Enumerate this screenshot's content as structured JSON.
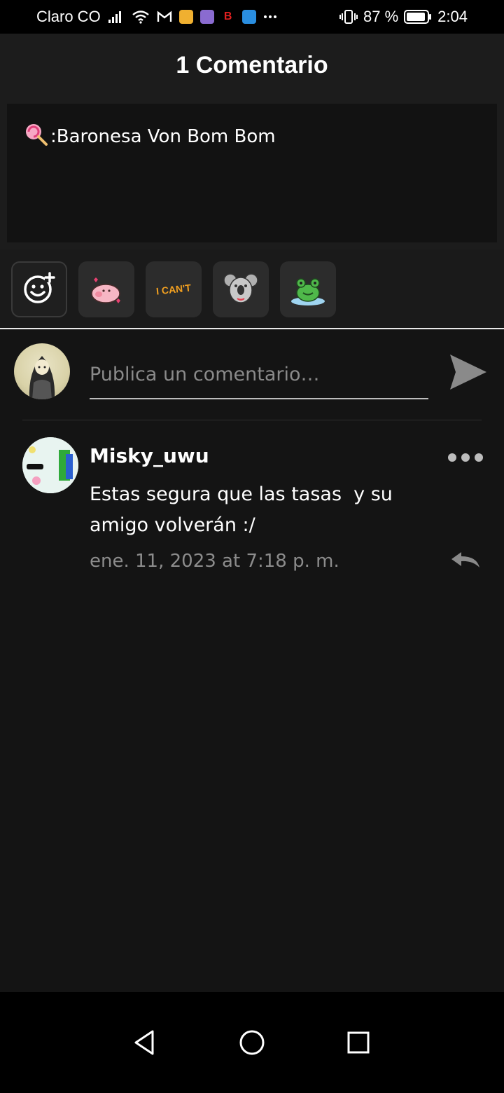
{
  "status_bar": {
    "carrier": "Claro CO",
    "battery_percent": "87 %",
    "time": "2:04",
    "icons": [
      "signal-icon",
      "wifi-icon",
      "gmail-icon",
      "app-icon",
      "app-icon",
      "app-icon",
      "app-icon",
      "more-notifications-icon",
      "vibrate-icon",
      "battery-icon"
    ]
  },
  "header": {
    "title": "1 Comentario"
  },
  "post": {
    "emoji": "🍭",
    "text": ":Baronesa Von Bom Bom"
  },
  "stickers": {
    "items": [
      {
        "name": "add-sticker-icon"
      },
      {
        "name": "pig-sticker"
      },
      {
        "name": "i-cant-sticker",
        "text": "I CAN'T"
      },
      {
        "name": "koala-sticker"
      },
      {
        "name": "frog-sticker"
      }
    ]
  },
  "compose": {
    "placeholder": "Publica un comentario…",
    "value": ""
  },
  "comment": {
    "username": "Misky_uwu",
    "body": "Estas segura que las tasas  y su amigo volverán :/",
    "timestamp": "ene. 11, 2023 at 7:18 p. m."
  },
  "colors": {
    "background": "#141414",
    "header": "#1c1c1c",
    "muted_text": "#8c8c8c",
    "sticker_tile": "#2c2c2c"
  }
}
